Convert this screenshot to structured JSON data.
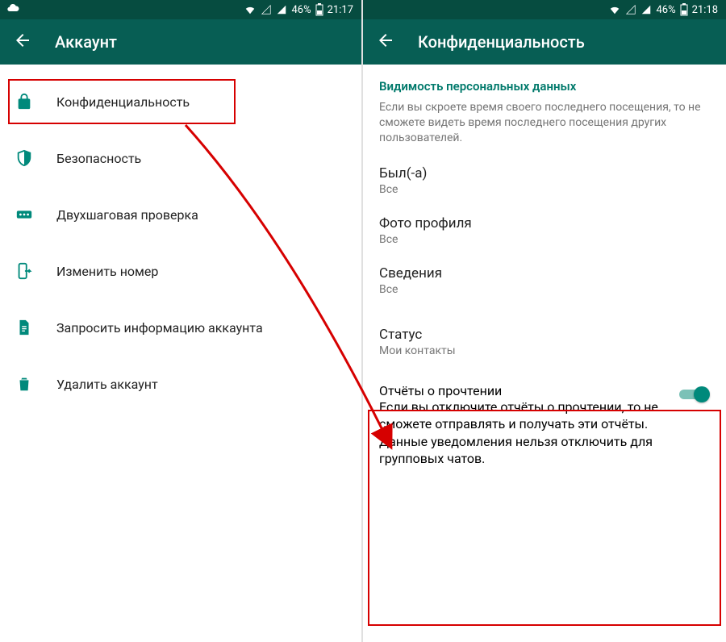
{
  "left_phone": {
    "status": {
      "battery": "46%",
      "time": "21:17"
    },
    "title": "Аккаунт",
    "items": [
      {
        "label": "Конфиденциальность"
      },
      {
        "label": "Безопасность"
      },
      {
        "label": "Двухшаговая проверка"
      },
      {
        "label": "Изменить номер"
      },
      {
        "label": "Запросить информацию аккаунта"
      },
      {
        "label": "Удалить аккаунт"
      }
    ]
  },
  "right_phone": {
    "status": {
      "battery": "46%",
      "time": "21:18"
    },
    "title": "Конфиденциальность",
    "section_header": "Видимость персональных данных",
    "section_desc": "Если вы скроете время своего последнего посещения, то не сможете видеть время последнего посещения других пользователей.",
    "settings": [
      {
        "title": "Был(-а)",
        "sub": "Все"
      },
      {
        "title": "Фото профиля",
        "sub": "Все"
      },
      {
        "title": "Сведения",
        "sub": "Все"
      },
      {
        "title": "Статус",
        "sub": "Мои контакты"
      }
    ],
    "read_receipts": {
      "title": "Отчёты о прочтении",
      "desc": "Если вы отключите отчёты о прочтении, то не сможете отправлять и получать эти отчёты. Данные уведомления нельзя отключить для групповых чатов."
    }
  }
}
